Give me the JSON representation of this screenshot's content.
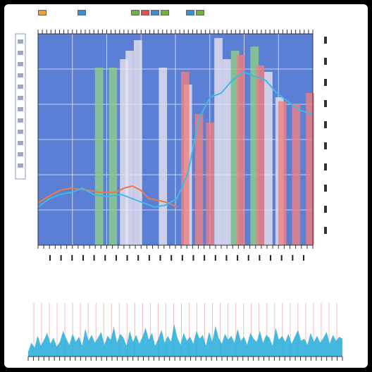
{
  "colors": {
    "background": "#5b7fd4",
    "grid": "#e8ecf5",
    "bar_red": "#f08080",
    "bar_green": "#8fd08a",
    "bar_white": "#e8e4ef",
    "line_orange": "#f07840",
    "line_cyan": "#40b8e0",
    "bottom_fill": "#30b0dc",
    "bottom_lines": "#e89090"
  },
  "legend_colors": [
    "#f0a030",
    "#3a8fd0",
    "#70b040",
    "#e05050",
    "#3a8fd0",
    "#70b040"
  ],
  "caption": {
    "line1": "",
    "line2": ""
  },
  "chart_data": [
    {
      "type": "bar",
      "title": "",
      "xlabel": "",
      "ylabel": "",
      "ylim": [
        0,
        100
      ],
      "grid": true,
      "legend": "top",
      "x": [
        0,
        1,
        2,
        3,
        4,
        5,
        6,
        7,
        8,
        9,
        10,
        11,
        12,
        13,
        14,
        15,
        16,
        17,
        18,
        19,
        20,
        21,
        22,
        23,
        24,
        25,
        26,
        27,
        28,
        29,
        30,
        31,
        32,
        33,
        34,
        35,
        36,
        37,
        38,
        39,
        40,
        41,
        42,
        43,
        44,
        45,
        46,
        47,
        48,
        49,
        50,
        51,
        52,
        53,
        54,
        55,
        56,
        57,
        58,
        59,
        60,
        61,
        62,
        63,
        64,
        65,
        66,
        67,
        68,
        69,
        70,
        71,
        72,
        73,
        74,
        75,
        76,
        77,
        78,
        79,
        80,
        81,
        82,
        83,
        84,
        85,
        86,
        87,
        88,
        89,
        90,
        91,
        92,
        93,
        94,
        95,
        96,
        97,
        98,
        99
      ],
      "series": [
        {
          "color": "#8fd08a",
          "bars": [
            [
              22,
              84
            ],
            [
              27,
              84
            ],
            [
              71,
              92
            ],
            [
              78,
              94
            ]
          ]
        },
        {
          "color": "#e8e4ef",
          "bars": [
            [
              31,
              88
            ],
            [
              33,
              92
            ],
            [
              36,
              97
            ],
            [
              45,
              84
            ],
            [
              54,
              76
            ],
            [
              65,
              98
            ],
            [
              68,
              88
            ],
            [
              83,
              82
            ],
            [
              87,
              70
            ]
          ]
        },
        {
          "color": "#f08080",
          "bars": [
            [
              53,
              82
            ],
            [
              58,
              62
            ],
            [
              62,
              58
            ],
            [
              73,
              90
            ],
            [
              80,
              85
            ],
            [
              88,
              68
            ],
            [
              93,
              67
            ],
            [
              98,
              72
            ]
          ]
        }
      ],
      "lines": [
        {
          "color": "#f07840",
          "points": [
            [
              0,
              20
            ],
            [
              5,
              24
            ],
            [
              8,
              26
            ],
            [
              12,
              27
            ],
            [
              18,
              26
            ],
            [
              22,
              25
            ],
            [
              28,
              25
            ],
            [
              31,
              27
            ],
            [
              34,
              28
            ],
            [
              37,
              26
            ],
            [
              40,
              22
            ],
            [
              44,
              21
            ],
            [
              47,
              20
            ],
            [
              50,
              18
            ]
          ]
        },
        {
          "color": "#40b8e0",
          "points": [
            [
              0,
              18
            ],
            [
              4,
              22
            ],
            [
              8,
              24
            ],
            [
              12,
              25
            ],
            [
              16,
              27
            ],
            [
              20,
              24
            ],
            [
              25,
              23
            ],
            [
              30,
              24
            ],
            [
              34,
              22
            ],
            [
              38,
              20
            ],
            [
              42,
              18
            ],
            [
              46,
              19
            ],
            [
              50,
              22
            ],
            [
              54,
              34
            ],
            [
              58,
              60
            ],
            [
              62,
              70
            ],
            [
              66,
              72
            ],
            [
              70,
              78
            ],
            [
              74,
              82
            ],
            [
              78,
              80
            ],
            [
              82,
              78
            ],
            [
              86,
              72
            ],
            [
              90,
              68
            ],
            [
              94,
              64
            ],
            [
              99,
              62
            ]
          ]
        }
      ]
    },
    {
      "type": "area",
      "title": "",
      "xlabel": "",
      "ylabel": "",
      "ylim": [
        0,
        100
      ],
      "grid": false,
      "values": [
        10,
        28,
        18,
        42,
        22,
        34,
        48,
        26,
        38,
        20,
        30,
        52,
        36,
        24,
        46,
        30,
        40,
        22,
        56,
        32,
        44,
        28,
        38,
        50,
        24,
        42,
        34,
        60,
        28,
        46,
        38,
        22,
        52,
        30,
        44,
        26,
        40,
        58,
        34,
        48,
        22,
        36,
        54,
        28,
        42,
        30,
        66,
        38,
        24,
        48,
        32,
        40,
        26,
        52,
        36,
        44,
        22,
        50,
        30,
        62,
        38,
        26,
        46,
        34,
        42,
        28,
        56,
        32,
        40,
        24,
        48,
        36,
        30,
        52,
        28,
        44,
        38,
        22,
        58,
        34,
        42,
        30,
        46,
        26,
        40,
        54,
        32,
        36,
        24,
        48,
        30,
        42,
        28,
        38,
        50,
        26,
        44,
        32,
        40,
        36
      ]
    }
  ]
}
